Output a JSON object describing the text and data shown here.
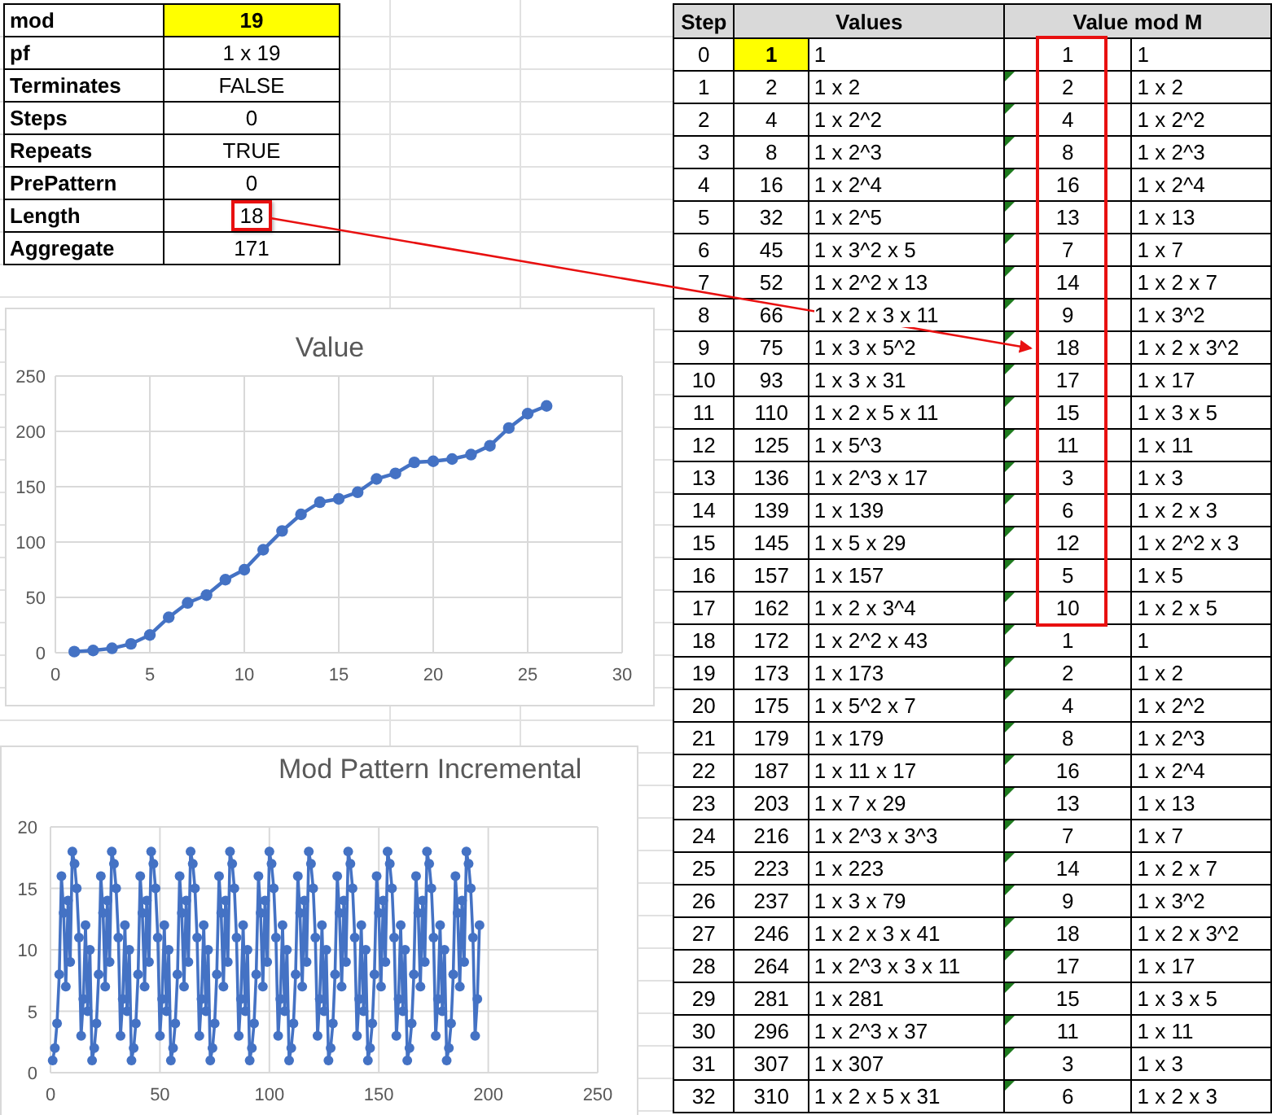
{
  "settings": [
    {
      "label": "mod",
      "value": "19",
      "highlighted": true,
      "boxed": false
    },
    {
      "label": "pf",
      "value": "1 x 19",
      "highlighted": false,
      "boxed": false
    },
    {
      "label": "Terminates",
      "value": "FALSE",
      "highlighted": false,
      "boxed": false
    },
    {
      "label": "Steps",
      "value": "0",
      "highlighted": false,
      "boxed": false
    },
    {
      "label": "Repeats",
      "value": "TRUE",
      "highlighted": false,
      "boxed": false
    },
    {
      "label": "PrePattern",
      "value": "0",
      "highlighted": false,
      "boxed": false
    },
    {
      "label": "Length",
      "value": "18",
      "highlighted": false,
      "boxed": true
    },
    {
      "label": "Aggregate",
      "value": "171",
      "highlighted": false,
      "boxed": false
    }
  ],
  "value_chart": {
    "chart_data": {
      "type": "line",
      "title": "Value",
      "x": [
        1,
        2,
        3,
        4,
        5,
        6,
        7,
        8,
        9,
        10,
        11,
        12,
        13,
        14,
        15,
        16,
        17,
        18,
        19,
        20,
        21,
        22,
        23,
        24,
        25,
        26
      ],
      "grid": true,
      "series": [
        {
          "color": "#4472c4",
          "marker": "circle",
          "values": [
            1,
            2,
            4,
            8,
            16,
            32,
            45,
            52,
            66,
            75,
            93,
            110,
            125,
            136,
            139,
            145,
            157,
            162,
            172,
            173,
            175,
            179,
            187,
            203,
            216,
            223
          ]
        }
      ],
      "xlim": [
        0,
        30
      ],
      "ylim": [
        0,
        250
      ],
      "xticks": [
        0,
        5,
        10,
        15,
        20,
        25,
        30
      ],
      "yticks": [
        0,
        50,
        100,
        150,
        200,
        250
      ]
    }
  },
  "mod_chart": {
    "chart_data": {
      "type": "line",
      "title": "Mod Pattern Incremental",
      "xlim": [
        0,
        250
      ],
      "ylim": [
        0,
        20
      ],
      "xticks": [
        0,
        50,
        100,
        150,
        200,
        250
      ],
      "yticks": [
        0,
        5,
        10,
        15,
        20
      ],
      "grid": true,
      "x": [
        1,
        2,
        3,
        4,
        5,
        6,
        7,
        8,
        9,
        10,
        11,
        12,
        13,
        14,
        15,
        16,
        17,
        18,
        19,
        20,
        21,
        22,
        23,
        24,
        25,
        26,
        27,
        28,
        29,
        30,
        31,
        32,
        33,
        34,
        35,
        36,
        37,
        38,
        39,
        40,
        41,
        42,
        43,
        44,
        45,
        46,
        47,
        48,
        49,
        50,
        51,
        52,
        53,
        54,
        55,
        56,
        57,
        58,
        59,
        60,
        61,
        62,
        63,
        64,
        65,
        66,
        67,
        68,
        69,
        70,
        71,
        72,
        73,
        74,
        75,
        76,
        77,
        78,
        79,
        80,
        81,
        82,
        83,
        84,
        85,
        86,
        87,
        88,
        89,
        90,
        91,
        92,
        93,
        94,
        95,
        96,
        97,
        98,
        99,
        100,
        101,
        102,
        103,
        104,
        105,
        106,
        107,
        108,
        109,
        110,
        111,
        112,
        113,
        114,
        115,
        116,
        117,
        118,
        119,
        120,
        121,
        122,
        123,
        124,
        125,
        126,
        127,
        128,
        129,
        130,
        131,
        132,
        133,
        134,
        135,
        136,
        137,
        138,
        139,
        140,
        141,
        142,
        143,
        144,
        145,
        146,
        147,
        148,
        149,
        150,
        151,
        152,
        153,
        154,
        155,
        156,
        157,
        158,
        159,
        160,
        161,
        162,
        163,
        164,
        165,
        166,
        167,
        168,
        169,
        170,
        171,
        172,
        173,
        174,
        175,
        176,
        177,
        178,
        179,
        180,
        181,
        182,
        183,
        184,
        185,
        186,
        187,
        188,
        189,
        190,
        191,
        192,
        193,
        194,
        195,
        196
      ],
      "series": [
        {
          "color": "#4472c4",
          "marker": "circle",
          "values": [
            1,
            2,
            4,
            8,
            16,
            13,
            7,
            14,
            9,
            18,
            17,
            15,
            11,
            3,
            6,
            12,
            5,
            10,
            1,
            2,
            4,
            8,
            16,
            13,
            7,
            14,
            9,
            18,
            17,
            15,
            11,
            3,
            6,
            12,
            5,
            10,
            1,
            2,
            4,
            8,
            16,
            13,
            7,
            14,
            9,
            18,
            17,
            15,
            11,
            3,
            6,
            12,
            5,
            10,
            1,
            2,
            4,
            8,
            16,
            13,
            7,
            14,
            9,
            18,
            17,
            15,
            11,
            3,
            6,
            12,
            5,
            10,
            1,
            2,
            4,
            8,
            16,
            13,
            7,
            14,
            9,
            18,
            17,
            15,
            11,
            3,
            6,
            12,
            5,
            10,
            1,
            2,
            4,
            8,
            16,
            13,
            7,
            14,
            9,
            18,
            17,
            15,
            11,
            3,
            6,
            12,
            5,
            10,
            1,
            2,
            4,
            8,
            16,
            13,
            7,
            14,
            9,
            18,
            17,
            15,
            11,
            3,
            6,
            12,
            5,
            10,
            1,
            2,
            4,
            8,
            16,
            13,
            7,
            14,
            9,
            18,
            17,
            15,
            11,
            3,
            6,
            12,
            5,
            10,
            1,
            2,
            4,
            8,
            16,
            13,
            7,
            14,
            9,
            18,
            17,
            15,
            11,
            3,
            6,
            12,
            5,
            10,
            1,
            2,
            4,
            8,
            16,
            13,
            7,
            14,
            9,
            18,
            17,
            15,
            11,
            3,
            6,
            12,
            5,
            10,
            1,
            2,
            4,
            8,
            16,
            13,
            7,
            14,
            9,
            18,
            17,
            15,
            11,
            3,
            6,
            12
          ]
        }
      ]
    }
  },
  "table": {
    "columns": [
      "Step",
      "Values",
      "Value mod M"
    ],
    "rows": [
      {
        "step": "0",
        "value": "1",
        "factors": "1",
        "mod": "1",
        "mod_factors": "1",
        "highlighted": true,
        "flagged": false,
        "in_pattern": true
      },
      {
        "step": "1",
        "value": "2",
        "factors": "1 x 2",
        "mod": "2",
        "mod_factors": "1 x 2",
        "highlighted": false,
        "flagged": true,
        "in_pattern": true
      },
      {
        "step": "2",
        "value": "4",
        "factors": "1 x 2^2",
        "mod": "4",
        "mod_factors": "1 x 2^2",
        "highlighted": false,
        "flagged": true,
        "in_pattern": true
      },
      {
        "step": "3",
        "value": "8",
        "factors": "1 x 2^3",
        "mod": "8",
        "mod_factors": "1 x 2^3",
        "highlighted": false,
        "flagged": true,
        "in_pattern": true
      },
      {
        "step": "4",
        "value": "16",
        "factors": "1 x 2^4",
        "mod": "16",
        "mod_factors": "1 x 2^4",
        "highlighted": false,
        "flagged": true,
        "in_pattern": true
      },
      {
        "step": "5",
        "value": "32",
        "factors": "1 x 2^5",
        "mod": "13",
        "mod_factors": "1 x 13",
        "highlighted": false,
        "flagged": true,
        "in_pattern": true
      },
      {
        "step": "6",
        "value": "45",
        "factors": "1 x 3^2 x 5",
        "mod": "7",
        "mod_factors": "1 x 7",
        "highlighted": false,
        "flagged": true,
        "in_pattern": true
      },
      {
        "step": "7",
        "value": "52",
        "factors": "1 x 2^2 x 13",
        "mod": "14",
        "mod_factors": "1 x 2 x 7",
        "highlighted": false,
        "flagged": true,
        "in_pattern": true
      },
      {
        "step": "8",
        "value": "66",
        "factors": "1 x 2 x 3 x 11",
        "mod": "9",
        "mod_factors": "1 x 3^2",
        "highlighted": false,
        "flagged": true,
        "in_pattern": true
      },
      {
        "step": "9",
        "value": "75",
        "factors": "1 x 3 x 5^2",
        "mod": "18",
        "mod_factors": "1 x 2 x 3^2",
        "highlighted": false,
        "flagged": true,
        "in_pattern": true
      },
      {
        "step": "10",
        "value": "93",
        "factors": "1 x 3 x 31",
        "mod": "17",
        "mod_factors": "1 x 17",
        "highlighted": false,
        "flagged": true,
        "in_pattern": true
      },
      {
        "step": "11",
        "value": "110",
        "factors": "1 x 2 x 5 x 11",
        "mod": "15",
        "mod_factors": "1 x 3 x 5",
        "highlighted": false,
        "flagged": true,
        "in_pattern": true
      },
      {
        "step": "12",
        "value": "125",
        "factors": "1 x 5^3",
        "mod": "11",
        "mod_factors": "1 x 11",
        "highlighted": false,
        "flagged": true,
        "in_pattern": true
      },
      {
        "step": "13",
        "value": "136",
        "factors": "1 x 2^3 x 17",
        "mod": "3",
        "mod_factors": "1 x 3",
        "highlighted": false,
        "flagged": true,
        "in_pattern": true
      },
      {
        "step": "14",
        "value": "139",
        "factors": "1 x 139",
        "mod": "6",
        "mod_factors": "1 x 2 x 3",
        "highlighted": false,
        "flagged": true,
        "in_pattern": true
      },
      {
        "step": "15",
        "value": "145",
        "factors": "1 x 5 x 29",
        "mod": "12",
        "mod_factors": "1 x 2^2 x 3",
        "highlighted": false,
        "flagged": true,
        "in_pattern": true
      },
      {
        "step": "16",
        "value": "157",
        "factors": "1 x 157",
        "mod": "5",
        "mod_factors": "1 x 5",
        "highlighted": false,
        "flagged": true,
        "in_pattern": true
      },
      {
        "step": "17",
        "value": "162",
        "factors": "1 x 2 x 3^4",
        "mod": "10",
        "mod_factors": "1 x 2 x 5",
        "highlighted": false,
        "flagged": true,
        "in_pattern": true
      },
      {
        "step": "18",
        "value": "172",
        "factors": "1 x 2^2 x 43",
        "mod": "1",
        "mod_factors": "1",
        "highlighted": false,
        "flagged": true,
        "in_pattern": false
      },
      {
        "step": "19",
        "value": "173",
        "factors": "1 x 173",
        "mod": "2",
        "mod_factors": "1 x 2",
        "highlighted": false,
        "flagged": true,
        "in_pattern": false
      },
      {
        "step": "20",
        "value": "175",
        "factors": "1 x 5^2 x 7",
        "mod": "4",
        "mod_factors": "1 x 2^2",
        "highlighted": false,
        "flagged": true,
        "in_pattern": false
      },
      {
        "step": "21",
        "value": "179",
        "factors": "1 x 179",
        "mod": "8",
        "mod_factors": "1 x 2^3",
        "highlighted": false,
        "flagged": true,
        "in_pattern": false
      },
      {
        "step": "22",
        "value": "187",
        "factors": "1 x 11 x 17",
        "mod": "16",
        "mod_factors": "1 x 2^4",
        "highlighted": false,
        "flagged": true,
        "in_pattern": false
      },
      {
        "step": "23",
        "value": "203",
        "factors": "1 x 7 x 29",
        "mod": "13",
        "mod_factors": "1 x 13",
        "highlighted": false,
        "flagged": true,
        "in_pattern": false
      },
      {
        "step": "24",
        "value": "216",
        "factors": "1 x 2^3 x 3^3",
        "mod": "7",
        "mod_factors": "1 x 7",
        "highlighted": false,
        "flagged": true,
        "in_pattern": false
      },
      {
        "step": "25",
        "value": "223",
        "factors": "1 x 223",
        "mod": "14",
        "mod_factors": "1 x 2 x 7",
        "highlighted": false,
        "flagged": true,
        "in_pattern": false
      },
      {
        "step": "26",
        "value": "237",
        "factors": "1 x 3 x 79",
        "mod": "9",
        "mod_factors": "1 x 3^2",
        "highlighted": false,
        "flagged": true,
        "in_pattern": false
      },
      {
        "step": "27",
        "value": "246",
        "factors": "1 x 2 x 3 x 41",
        "mod": "18",
        "mod_factors": "1 x 2 x 3^2",
        "highlighted": false,
        "flagged": true,
        "in_pattern": false
      },
      {
        "step": "28",
        "value": "264",
        "factors": "1 x 2^3 x 3 x 11",
        "mod": "17",
        "mod_factors": "1 x 17",
        "highlighted": false,
        "flagged": true,
        "in_pattern": false
      },
      {
        "step": "29",
        "value": "281",
        "factors": "1 x 281",
        "mod": "15",
        "mod_factors": "1 x 3 x 5",
        "highlighted": false,
        "flagged": true,
        "in_pattern": false
      },
      {
        "step": "30",
        "value": "296",
        "factors": "1 x 2^3 x 37",
        "mod": "11",
        "mod_factors": "1 x 11",
        "highlighted": false,
        "flagged": true,
        "in_pattern": false
      },
      {
        "step": "31",
        "value": "307",
        "factors": "1 x 307",
        "mod": "3",
        "mod_factors": "1 x 3",
        "highlighted": false,
        "flagged": true,
        "in_pattern": false
      },
      {
        "step": "32",
        "value": "310",
        "factors": "1 x 2 x 5 x 31",
        "mod": "6",
        "mod_factors": "1 x 2 x 3",
        "highlighted": false,
        "flagged": true,
        "in_pattern": false
      }
    ]
  }
}
